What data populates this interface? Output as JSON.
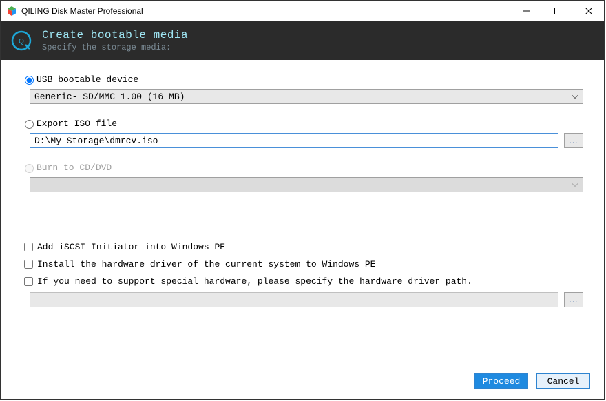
{
  "window": {
    "title": "QILING Disk Master Professional"
  },
  "header": {
    "title": "Create bootable media",
    "subtitle": "Specify the storage media:"
  },
  "options": {
    "usb": {
      "label": "USB bootable device",
      "selected_device": "Generic- SD/MMC 1.00 (16 MB)"
    },
    "iso": {
      "label": "Export ISO file",
      "path": "D:\\My Storage\\dmrcv.iso",
      "browse": "..."
    },
    "cd": {
      "label": "Burn to CD/DVD",
      "selected_device": ""
    }
  },
  "checks": {
    "iscsi": "Add iSCSI Initiator into Windows PE",
    "hw_driver": "Install the hardware driver of the current system to Windows PE",
    "special_hw": "If you need to support special hardware, please specify the hardware driver path.",
    "driver_path": "",
    "browse": "..."
  },
  "footer": {
    "proceed": "Proceed",
    "cancel": "Cancel"
  }
}
